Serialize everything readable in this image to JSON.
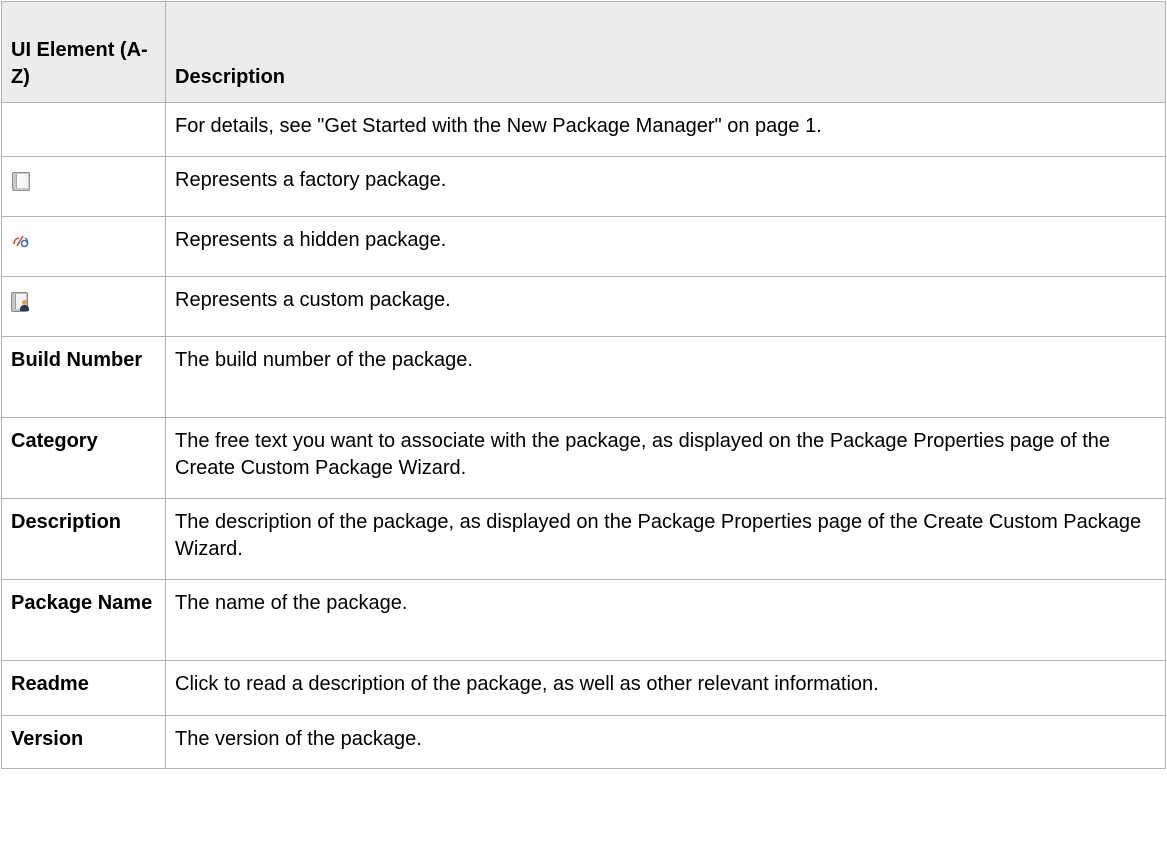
{
  "table": {
    "header": {
      "col1": "UI Element (A-Z)",
      "col2": "Description"
    },
    "link_row": {
      "description": "For details, see \"Get Started with the New Package Manager\" on page 1."
    },
    "icon_rows": [
      {
        "icon": "factory-package-icon",
        "description": "Represents a factory package."
      },
      {
        "icon": "hidden-package-icon",
        "description": "Represents a hidden package."
      },
      {
        "icon": "custom-package-icon",
        "description": "Represents a custom package."
      }
    ],
    "rows": [
      {
        "element": "Build Number",
        "description": "The build number of the package."
      },
      {
        "element": "Category",
        "description": "The free text you want to associate with the package, as displayed on the Package Properties page of the Create Custom Package Wizard."
      },
      {
        "element": "Description",
        "description": "The description of the package, as displayed on the Package Properties page of the Create Custom Package Wizard."
      },
      {
        "element": "Package Name",
        "description": "The name of the package."
      },
      {
        "element": "Readme",
        "description": "Click to read a description of the package, as well as other relevant information."
      },
      {
        "element": "Version",
        "description": "The version of the package."
      }
    ]
  },
  "colors": {
    "header_background": "#ececec",
    "border": "#b2b2b2",
    "hidden_icon_red": "#d9483b",
    "hidden_icon_blue": "#3d6fb8"
  }
}
